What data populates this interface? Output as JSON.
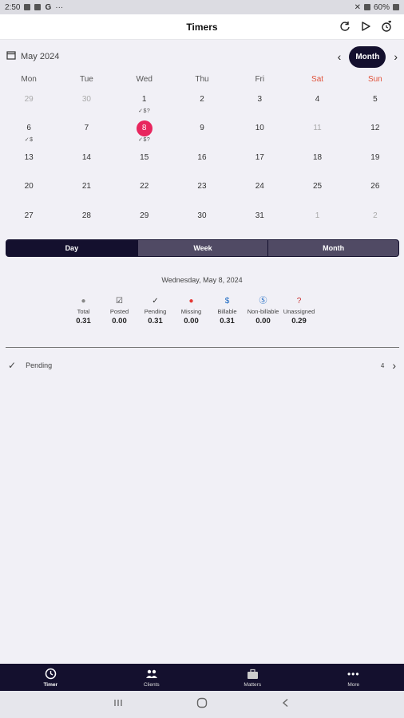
{
  "status_bar": {
    "time": "2:50",
    "battery": "60%"
  },
  "app_bar": {
    "title": "Timers"
  },
  "calendar": {
    "month_label": "May 2024",
    "view_button": "Month",
    "weekdays": [
      "Mon",
      "Tue",
      "Wed",
      "Thu",
      "Fri",
      "Sat",
      "Sun"
    ],
    "weeks": [
      [
        {
          "d": "29",
          "m": 1
        },
        {
          "d": "30",
          "m": 1
        },
        {
          "d": "1",
          "mark": "✓$?"
        },
        {
          "d": "2"
        },
        {
          "d": "3"
        },
        {
          "d": "4"
        },
        {
          "d": "5"
        }
      ],
      [
        {
          "d": "6",
          "mark": "✓$"
        },
        {
          "d": "7"
        },
        {
          "d": "8",
          "today": 1,
          "mark": "✓$?"
        },
        {
          "d": "9"
        },
        {
          "d": "10"
        },
        {
          "d": "11",
          "m": 1
        },
        {
          "d": "12"
        }
      ],
      [
        {
          "d": "13"
        },
        {
          "d": "14"
        },
        {
          "d": "15"
        },
        {
          "d": "16"
        },
        {
          "d": "17"
        },
        {
          "d": "18"
        },
        {
          "d": "19"
        }
      ],
      [
        {
          "d": "20"
        },
        {
          "d": "21"
        },
        {
          "d": "22"
        },
        {
          "d": "23"
        },
        {
          "d": "24"
        },
        {
          "d": "25"
        },
        {
          "d": "26"
        }
      ],
      [
        {
          "d": "27"
        },
        {
          "d": "28"
        },
        {
          "d": "29"
        },
        {
          "d": "30"
        },
        {
          "d": "31"
        },
        {
          "d": "1",
          "m": 1
        },
        {
          "d": "2",
          "m": 1
        }
      ]
    ]
  },
  "segments": {
    "day": "Day",
    "week": "Week",
    "month": "Month"
  },
  "summary": {
    "date": "Wednesday, May 8, 2024",
    "stats": [
      {
        "icon": "●",
        "label": "Total",
        "value": "0.31",
        "color": "#888"
      },
      {
        "icon": "☑",
        "label": "Posted",
        "value": "0.00",
        "color": "#333"
      },
      {
        "icon": "✓",
        "label": "Pending",
        "value": "0.31",
        "color": "#333"
      },
      {
        "icon": "●",
        "label": "Missing",
        "value": "0.00",
        "color": "#e53935"
      },
      {
        "icon": "$",
        "label": "Billable",
        "value": "0.31",
        "color": "#1565c0"
      },
      {
        "icon": "Ⓢ",
        "label": "Non-billable",
        "value": "0.00",
        "color": "#1565c0"
      },
      {
        "icon": "?",
        "label": "Unassigned",
        "value": "0.29",
        "color": "#c62828"
      }
    ]
  },
  "pending_row": {
    "label": "Pending",
    "count": "4"
  },
  "bottom_nav": {
    "timer": "Timer",
    "clients": "Clients",
    "matters": "Matters",
    "more": "More"
  }
}
